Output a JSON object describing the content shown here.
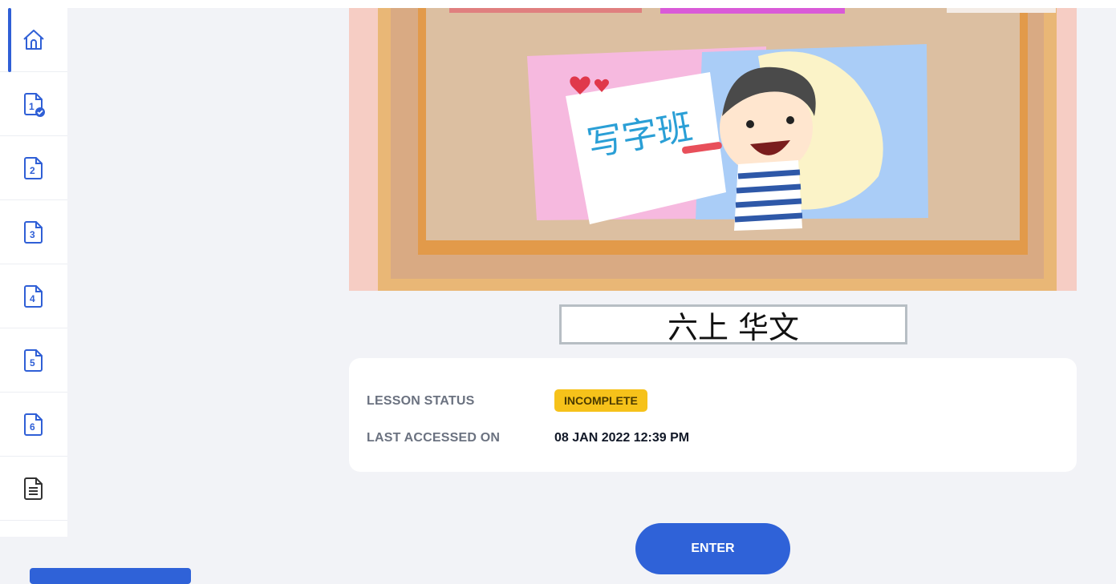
{
  "sidebar": {
    "items": [
      {
        "name": "home-icon",
        "label": "",
        "active": true
      },
      {
        "name": "lesson-1-completed-icon",
        "label": "1"
      },
      {
        "name": "lesson-2-icon",
        "label": "2"
      },
      {
        "name": "lesson-3-icon",
        "label": "3"
      },
      {
        "name": "lesson-4-icon",
        "label": "4"
      },
      {
        "name": "lesson-5-icon",
        "label": "5"
      },
      {
        "name": "lesson-6-icon",
        "label": "6"
      },
      {
        "name": "document-list-icon",
        "label": ""
      }
    ]
  },
  "hero": {
    "sign_text": "写字班"
  },
  "course": {
    "title": "六上 华文"
  },
  "lesson": {
    "status_label": "LESSON STATUS",
    "status_value": "INCOMPLETE",
    "last_accessed_label": "LAST ACCESSED ON",
    "last_accessed_value": "08 JAN 2022 12:39 PM"
  },
  "actions": {
    "enter_label": "ENTER"
  },
  "colors": {
    "accent": "#2f62d8",
    "status_badge": "#f6c21a",
    "background": "#f2f3f7"
  }
}
